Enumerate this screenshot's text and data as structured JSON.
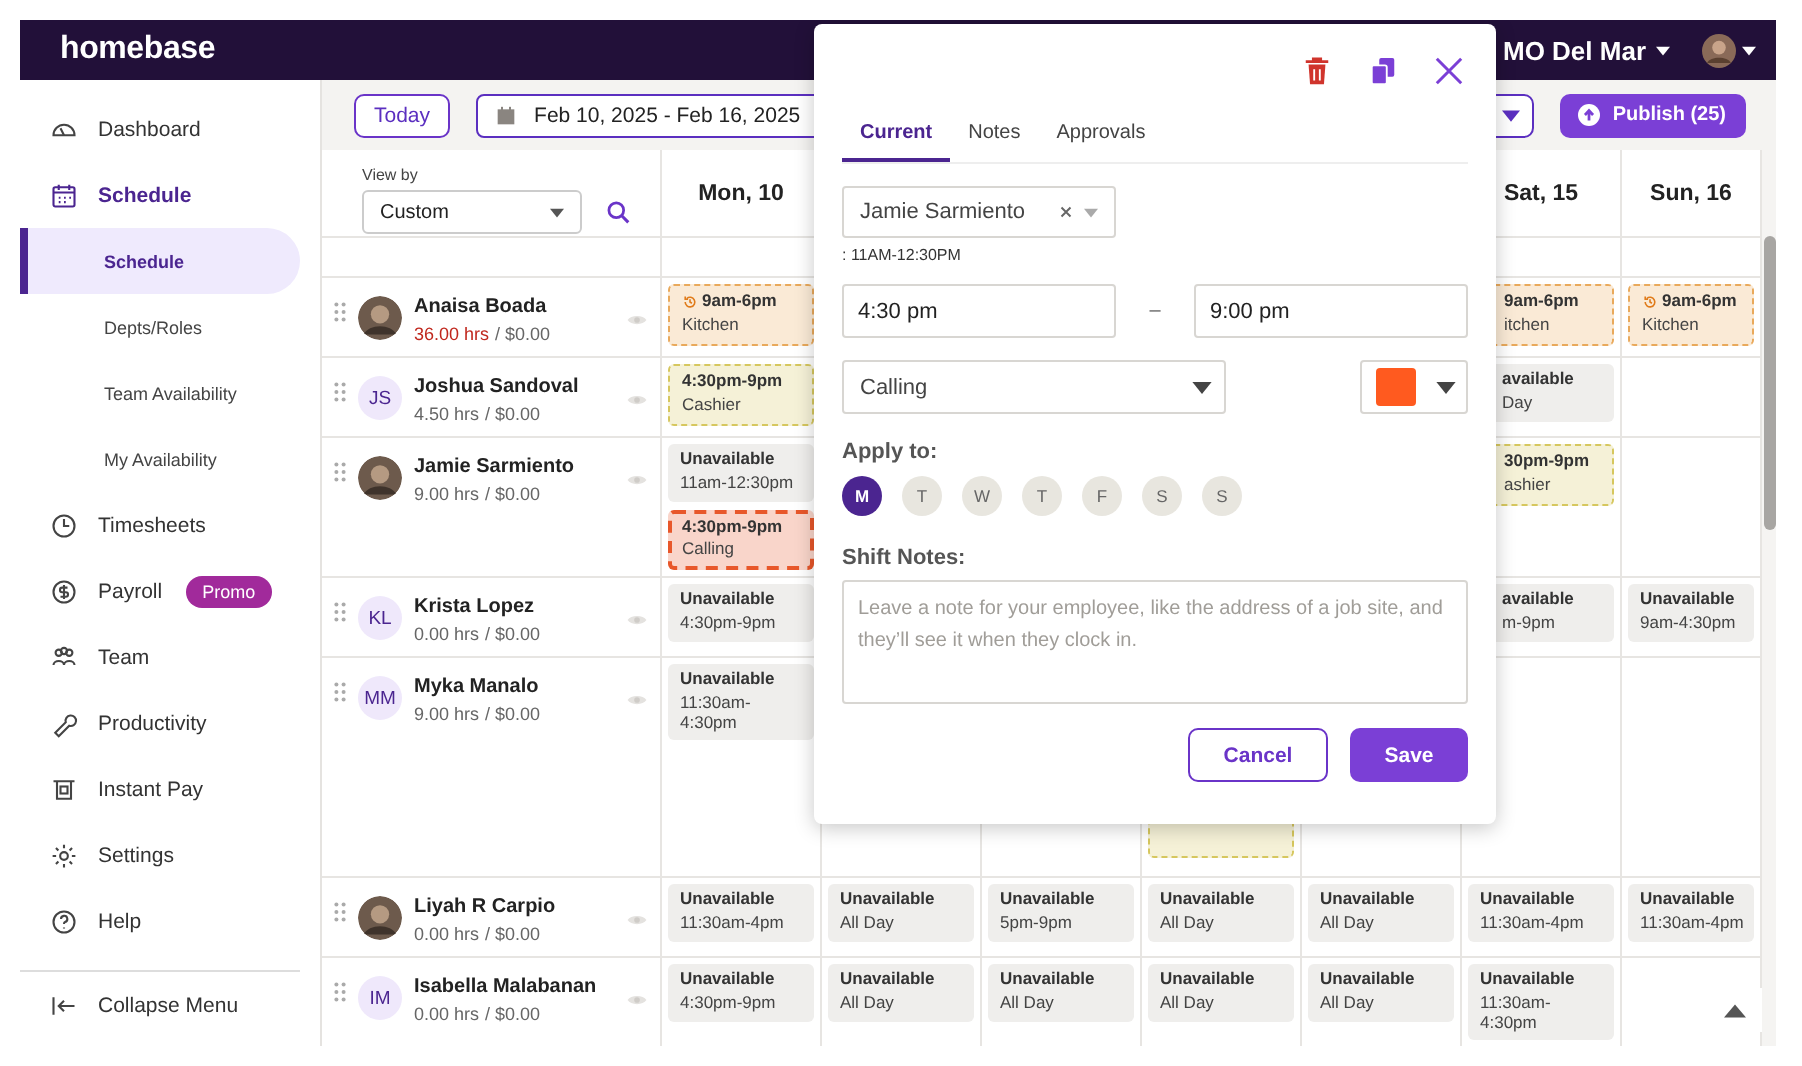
{
  "top_bar": {
    "logo": "homebase",
    "location": "MO Del Mar"
  },
  "sidebar": {
    "items": [
      {
        "label": "Dashboard",
        "selected": false
      },
      {
        "label": "Schedule",
        "selected": true,
        "children": [
          {
            "label": "Schedule",
            "selected": true
          },
          {
            "label": "Depts/Roles",
            "selected": false
          },
          {
            "label": "Team Availability",
            "selected": false
          },
          {
            "label": "My Availability",
            "selected": false
          }
        ]
      },
      {
        "label": "Timesheets",
        "selected": false
      },
      {
        "label": "Payroll",
        "selected": false,
        "badge": "Promo"
      },
      {
        "label": "Team",
        "selected": false
      },
      {
        "label": "Productivity",
        "selected": false
      },
      {
        "label": "Instant Pay",
        "selected": false
      },
      {
        "label": "Settings",
        "selected": false
      },
      {
        "label": "Help",
        "selected": false
      }
    ],
    "collapse": "Collapse Menu"
  },
  "toolbar": {
    "today": "Today",
    "date_range": "Feb 10, 2025 - Feb 16, 2025",
    "publish": "Publish (25)"
  },
  "grid": {
    "view_by_label": "View by",
    "view_by": "Custom",
    "days": {
      "mon": "Mon, 10",
      "sat": "Sat, 15",
      "sun": "Sun, 16"
    },
    "rows": [
      {
        "name": "Anaisa Boada",
        "avatar": {
          "kind": "photo"
        },
        "hours": "36.00 hrs",
        "pay": "/ $0.00",
        "over": true,
        "cells": [
          [
            {
              "kind": "shift",
              "time": "9am-6pm",
              "role": "Kitchen",
              "color": "#e9a95b",
              "history": true,
              "selected": false
            }
          ],
          null,
          null,
          null,
          null,
          [
            {
              "kind": "shift",
              "time": "9am-6pm",
              "role": "itchen",
              "color": "#e9a95b",
              "selected": false,
              "cut": true
            }
          ],
          [
            {
              "kind": "shift",
              "time": "9am-6pm",
              "role": "Kitchen",
              "color": "#e9a95b",
              "history": true,
              "selected": false
            }
          ]
        ]
      },
      {
        "name": "Joshua Sandoval",
        "avatar": {
          "kind": "initials",
          "text": "JS"
        },
        "hours": "4.50 hrs",
        "pay": "/ $0.00",
        "over": false,
        "cells": [
          [
            {
              "kind": "shift",
              "time": "4:30pm-9pm",
              "role": "Cashier",
              "color": "#d6c75e",
              "selected": false
            }
          ],
          null,
          null,
          null,
          null,
          [
            {
              "kind": "unavailable",
              "status": "available",
              "detail": "Day",
              "cut": true
            }
          ],
          null
        ]
      },
      {
        "name": "Jamie Sarmiento",
        "avatar": {
          "kind": "photo"
        },
        "hours": "9.00 hrs",
        "pay": "/ $0.00",
        "over": false,
        "cells": [
          [
            {
              "kind": "unavailable",
              "status": "Unavailable",
              "detail": "11am-12:30pm"
            },
            {
              "kind": "shift",
              "time": "4:30pm-9pm",
              "role": "Calling",
              "color": "#e8572a",
              "selected": true
            }
          ],
          null,
          null,
          null,
          null,
          [
            {
              "kind": "shift",
              "time": "30pm-9pm",
              "role": "ashier",
              "color": "#d6c75e",
              "selected": false,
              "cut": true
            }
          ],
          null
        ]
      },
      {
        "name": "Krista Lopez",
        "avatar": {
          "kind": "initials",
          "text": "KL"
        },
        "hours": "0.00 hrs",
        "pay": "/ $0.00",
        "over": false,
        "cells": [
          [
            {
              "kind": "unavailable",
              "status": "Unavailable",
              "detail": "4:30pm-9pm"
            }
          ],
          null,
          null,
          null,
          null,
          [
            {
              "kind": "unavailable",
              "status": "available",
              "detail": "m-9pm",
              "cut": true
            }
          ],
          [
            {
              "kind": "unavailable",
              "status": "Unavailable",
              "detail": "9am-4:30pm"
            }
          ]
        ]
      },
      {
        "name": "Myka Manalo",
        "avatar": {
          "kind": "initials",
          "text": "MM"
        },
        "hours": "9.00 hrs",
        "pay": "/ $0.00",
        "over": false,
        "cells": [
          [
            {
              "kind": "unavailable",
              "status": "Unavailable",
              "detail": "11:30am-4:30pm"
            }
          ],
          null,
          null,
          [
            {
              "kind": "shift",
              "color": "#d6c75e",
              "selected": false
            }
          ],
          null,
          null,
          null
        ]
      },
      {
        "name": "Liyah R Carpio",
        "avatar": {
          "kind": "photo"
        },
        "hours": "0.00 hrs",
        "pay": "/ $0.00",
        "over": false,
        "cells": [
          [
            {
              "kind": "unavailable",
              "status": "Unavailable",
              "detail": "11:30am-4pm"
            }
          ],
          [
            {
              "kind": "unavailable",
              "status": "Unavailable",
              "detail": "All Day"
            }
          ],
          [
            {
              "kind": "unavailable",
              "status": "Unavailable",
              "detail": "5pm-9pm"
            }
          ],
          [
            {
              "kind": "unavailable",
              "status": "Unavailable",
              "detail": "All Day"
            }
          ],
          [
            {
              "kind": "unavailable",
              "status": "Unavailable",
              "detail": "All Day"
            }
          ],
          [
            {
              "kind": "unavailable",
              "status": "Unavailable",
              "detail": "11:30am-4pm"
            }
          ],
          [
            {
              "kind": "unavailable",
              "status": "Unavailable",
              "detail": "11:30am-4pm"
            }
          ]
        ]
      },
      {
        "name": "Isabella Malabanan",
        "avatar": {
          "kind": "initials",
          "text": "IM"
        },
        "hours": "0.00 hrs",
        "pay": "/ $0.00",
        "over": false,
        "cells": [
          [
            {
              "kind": "unavailable",
              "status": "Unavailable",
              "detail": "4:30pm-9pm"
            }
          ],
          [
            {
              "kind": "unavailable",
              "status": "Unavailable",
              "detail": "All Day"
            }
          ],
          [
            {
              "kind": "unavailable",
              "status": "Unavailable",
              "detail": "All Day"
            }
          ],
          [
            {
              "kind": "unavailable",
              "status": "Unavailable",
              "detail": "All Day"
            }
          ],
          [
            {
              "kind": "unavailable",
              "status": "Unavailable",
              "detail": "All Day"
            }
          ],
          [
            {
              "kind": "unavailable",
              "status": "Unavailable",
              "detail": "11:30am-4:30pm"
            }
          ],
          null
        ]
      }
    ]
  },
  "shift_editor": {
    "tabs": [
      {
        "label": "Current",
        "selected": true
      },
      {
        "label": "Notes",
        "selected": false
      },
      {
        "label": "Approvals",
        "selected": false
      }
    ],
    "employee": "Jamie Sarmiento",
    "availability_note": ": 11AM-12:30PM",
    "start": "4:30 pm",
    "separator": "–",
    "end": "9:00 pm",
    "role": "Calling",
    "color": "#ff5a1f",
    "apply_label": "Apply to:",
    "apply_days": [
      {
        "label": "M",
        "selected": true
      },
      {
        "label": "T",
        "selected": false
      },
      {
        "label": "W",
        "selected": false
      },
      {
        "label": "T",
        "selected": false
      },
      {
        "label": "F",
        "selected": false
      },
      {
        "label": "S",
        "selected": false
      },
      {
        "label": "S",
        "selected": false
      }
    ],
    "notes_label": "Shift Notes:",
    "notes_placeholder": "Leave a note for your employee, like the address of a job site, and they’ll see it when they clock in.",
    "cancel": "Cancel",
    "save": "Save"
  }
}
